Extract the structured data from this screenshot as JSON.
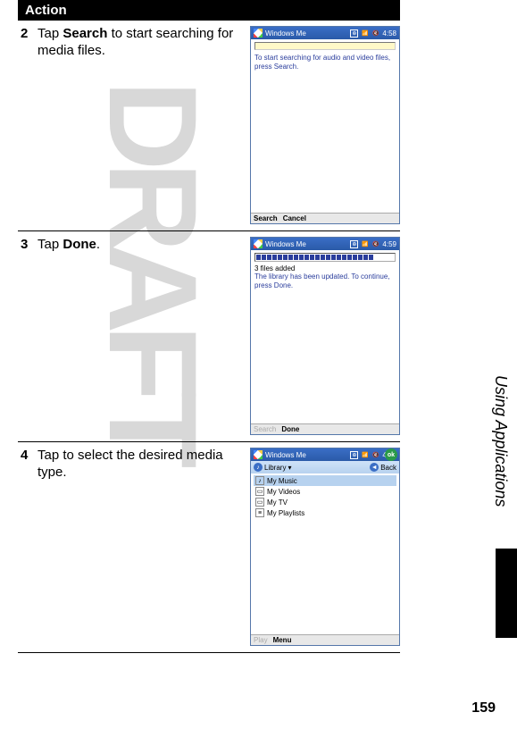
{
  "header": {
    "label": "Action"
  },
  "steps": [
    {
      "num": "2",
      "text_before": "Tap ",
      "keyword": "Search",
      "text_after": " to start searching for media files.",
      "screen": {
        "title": "Windows Me",
        "time": "4:58",
        "msg_line1": "To start searching for audio and video files,",
        "msg_line2": "press Search.",
        "btn_primary": "Search",
        "btn_secondary": "Cancel"
      }
    },
    {
      "num": "3",
      "text_before": "Tap ",
      "keyword": "Done",
      "text_after": ".",
      "screen": {
        "title": "Windows Me",
        "time": "4:59",
        "status": "3 files added",
        "msg_line1": "The library has been updated. To continue,",
        "msg_line2": "press Done.",
        "btn_primary_disabled": "Search",
        "btn_secondary": "Done"
      }
    },
    {
      "num": "4",
      "text_before": "Tap to select the desired media type.",
      "keyword": "",
      "text_after": "",
      "screen": {
        "title": "Windows Me",
        "time": "4:54",
        "library_label": "Library",
        "back_label": "Back",
        "ok_label": "ok",
        "items": [
          {
            "label": "My Music",
            "selected": true
          },
          {
            "label": "My Videos",
            "selected": false
          },
          {
            "label": "My TV",
            "selected": false
          },
          {
            "label": "My Playlists",
            "selected": false
          }
        ],
        "btn_primary_disabled": "Play",
        "btn_secondary": "Menu"
      }
    }
  ],
  "side_label": "Using Applications",
  "page_number": "159",
  "watermark": "DRAFT"
}
